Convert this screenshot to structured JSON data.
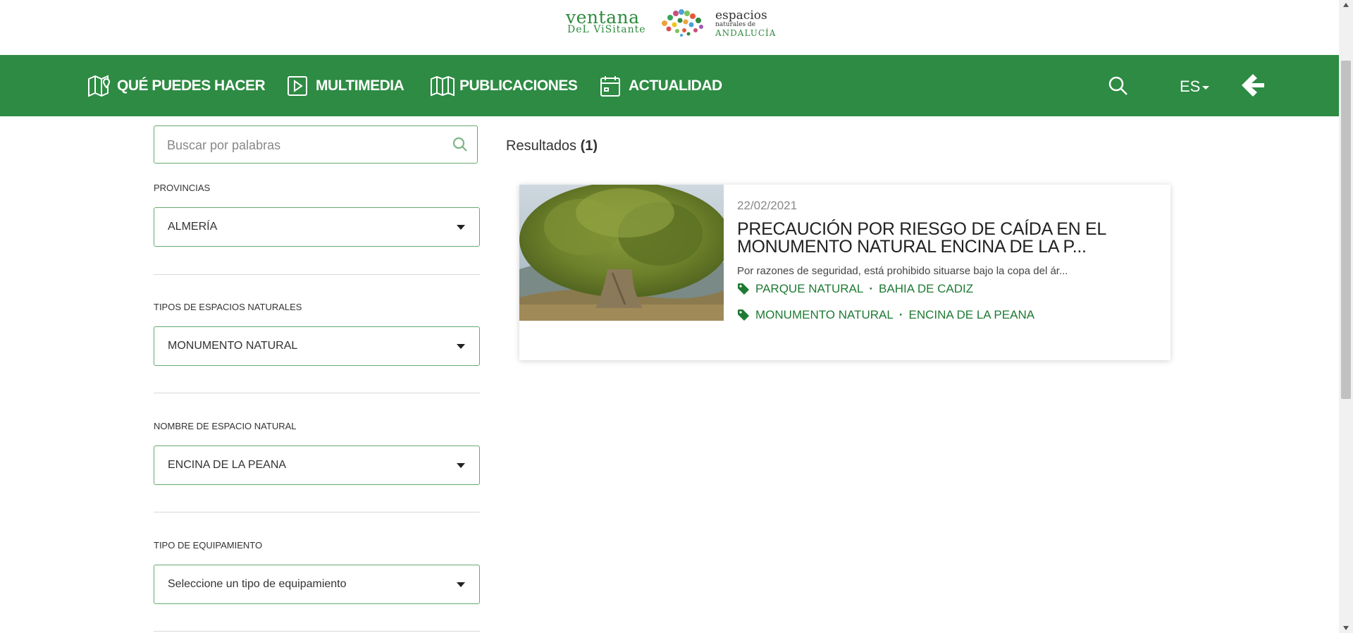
{
  "logo": {
    "line1": "ventana",
    "line2": "DeL ViSitante",
    "line3": "espacios",
    "line4": "naturales de",
    "line5": "ANDALUCÍA"
  },
  "nav": {
    "items": [
      {
        "label": "QUÉ PUEDES HACER",
        "icon": "map-pin-icon"
      },
      {
        "label": "MULTIMEDIA",
        "icon": "play-icon"
      },
      {
        "label": "PUBLICACIONES",
        "icon": "book-icon"
      },
      {
        "label": "ACTUALIDAD",
        "icon": "calendar-icon"
      }
    ],
    "lang": "ES",
    "accent": "#2d8b43"
  },
  "search": {
    "placeholder": "Buscar por palabras",
    "value": ""
  },
  "filters": [
    {
      "label": "PROVINCIAS",
      "value": "ALMERÍA"
    },
    {
      "label": "TIPOS DE ESPACIOS NATURALES",
      "value": "MONUMENTO NATURAL"
    },
    {
      "label": "NOMBRE DE ESPACIO NATURAL",
      "value": "ENCINA DE LA PEANA"
    },
    {
      "label": "TIPO DE EQUIPAMIENTO",
      "value": "Seleccione un tipo de equipamiento"
    }
  ],
  "results": {
    "label": "Resultados",
    "count": "(1)",
    "items": [
      {
        "date": "22/02/2021",
        "title": "PRECAUCIÓN POR RIESGO DE CAÍDA EN EL MONUMENTO NATURAL ENCINA DE LA P...",
        "description": "Por razones de seguridad, está prohibido situarse bajo la copa del ár...",
        "tags": [
          {
            "type": "PARQUE NATURAL",
            "name": "BAHIA DE CADIZ"
          },
          {
            "type": "MONUMENTO NATURAL",
            "name": "ENCINA DE LA PEANA"
          }
        ]
      }
    ]
  }
}
